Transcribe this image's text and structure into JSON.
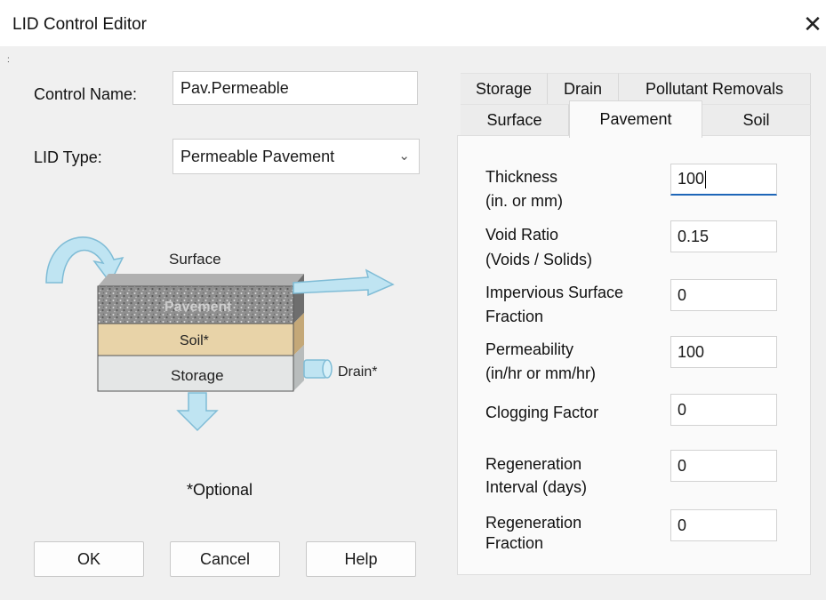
{
  "window": {
    "title": "LID Control Editor",
    "close_glyph": "✕"
  },
  "form": {
    "control_name_label": "Control Name:",
    "control_name_value": "Pav.Permeable",
    "lid_type_label": "LID Type:",
    "lid_type_value": "Permeable Pavement",
    "dropdown_glyph": "⌄"
  },
  "diagram": {
    "surface": "Surface",
    "pavement": "Pavement",
    "soil": "Soil*",
    "storage": "Storage",
    "drain": "Drain*",
    "optional_note": "*Optional"
  },
  "buttons": {
    "ok": "OK",
    "cancel": "Cancel",
    "help": "Help"
  },
  "tabs": {
    "upper": [
      "Storage",
      "Drain",
      "Pollutant Removals"
    ],
    "lower": [
      "Surface",
      "Pavement",
      "Soil"
    ],
    "active": "Pavement"
  },
  "pavement_fields": [
    {
      "label_line1": "Thickness",
      "label_line2": "(in. or mm)",
      "value": "100"
    },
    {
      "label_line1": "Void Ratio",
      "label_line2": "(Voids / Solids)",
      "value": "0.15"
    },
    {
      "label_line1": "Impervious Surface",
      "label_line2": "Fraction",
      "value": "0"
    },
    {
      "label_line1": "Permeability",
      "label_line2": "(in/hr or mm/hr)",
      "value": "100"
    },
    {
      "label_line1": "Clogging Factor",
      "label_line2": "",
      "value": "0"
    },
    {
      "label_line1": "Regeneration",
      "label_line2": "Interval (days)",
      "value": "0"
    },
    {
      "label_line1": "Regeneration",
      "label_line2": "Fraction",
      "value": "0"
    }
  ],
  "colors": {
    "dialog_bg": "#f0f0f0",
    "panel_bg": "#fafafa",
    "focus_underline": "#1e66b8",
    "arrow_fill": "#bfe4f2",
    "arrow_stroke": "#7fbcd6",
    "soil_fill": "#e8d3a8",
    "storage_fill": "#e4e6e6",
    "pavement_fill": "#8f8f8f"
  }
}
